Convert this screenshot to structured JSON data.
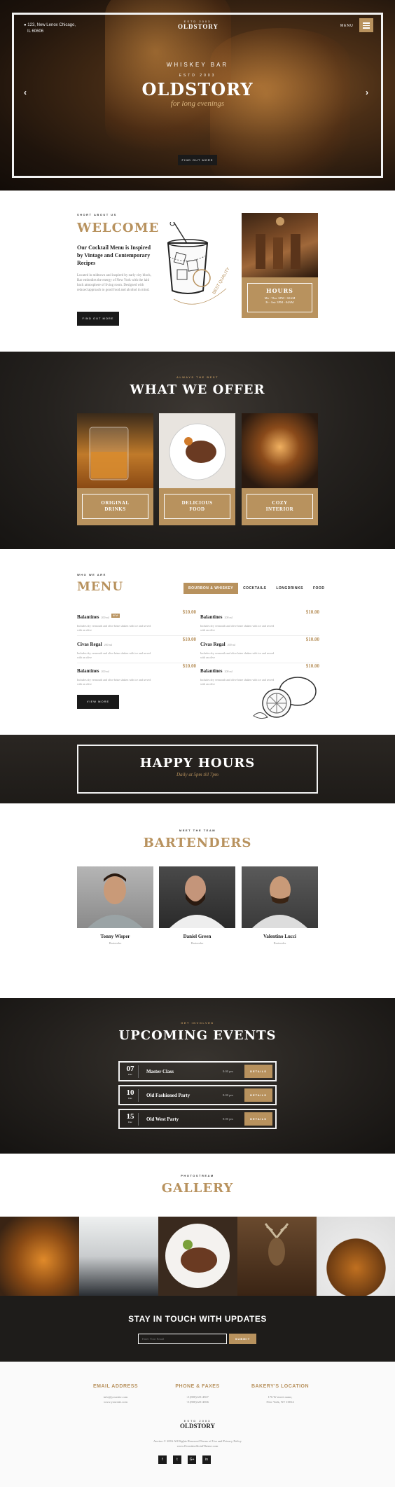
{
  "hero": {
    "address_line1": "123, New Lenox Chicago,",
    "address_line2": "IL 60606",
    "logo_est": "ESTD 2003",
    "logo_name": "OLDSTORY",
    "menu_label": "MENU",
    "arch_text": "WHISKEY BAR",
    "est_text": "ESTD 2003",
    "title": "OLDSTORY",
    "tagline": "for long evenings",
    "cta": "FIND OUT MORE"
  },
  "about": {
    "label": "SHORT ABOUT US",
    "title": "WELCOME",
    "lead": "Our Cocktail Menu is Inspired by Vintage and Contemporary Recipes",
    "body": "Located in midtown and inspired by early city block, Bar embodies the energy of New York with the laid back atmosphere of living room. Designed with relaxed approach to good food and alcohol in mind.",
    "button": "FIND OUT MORE",
    "sketch_text": "BEST QUALITY",
    "hours_title": "HOURS",
    "hours_line1": "Mo - Thu: 3PM - 02AM",
    "hours_line2": "Fr - Sat: 3PM - 04AM"
  },
  "offer": {
    "label": "ALWAYS THE BEST",
    "title": "WHAT WE OFFER",
    "cards": [
      {
        "line1": "ORIGINAL",
        "line2": "DRINKS"
      },
      {
        "line1": "DELICIOUS",
        "line2": "FOOD"
      },
      {
        "line1": "COZY",
        "line2": "INTERIOR"
      }
    ]
  },
  "menu": {
    "label": "WHO WE ARE",
    "title": "MENU",
    "tabs": [
      "BOURBON & WHISKEY",
      "COCKTAILS",
      "LONGDRINKS",
      "FOOD"
    ],
    "items": [
      {
        "name": "Balantines",
        "size": "200 ml",
        "badge": "NEW",
        "price": "$10.00",
        "desc": "Includes dry vermouth and olive brine shaken with ice and served with an olive"
      },
      {
        "name": "Balantines",
        "size": "200 ml",
        "badge": "",
        "price": "$10.00",
        "desc": "Includes dry vermouth and olive brine shaken with ice and served with an olive"
      },
      {
        "name": "Civas Regal",
        "size": "200 ml",
        "badge": "",
        "price": "$10.00",
        "desc": "Includes dry vermouth and olive brine shaken with ice and served with an olive"
      },
      {
        "name": "Civas Regal",
        "size": "200 ml",
        "badge": "",
        "price": "$10.00",
        "desc": "Includes dry vermouth and olive brine shaken with ice and served with an olive"
      },
      {
        "name": "Balantines",
        "size": "200 ml",
        "badge": "",
        "price": "$10.00",
        "desc": "Includes dry vermouth and olive brine shaken with ice and served with an olive"
      },
      {
        "name": "Balantines",
        "size": "200 ml",
        "badge": "",
        "price": "$10.00",
        "desc": "Includes dry vermouth and olive brine shaken with ice and served with an olive"
      }
    ],
    "button": "VIEW MORE"
  },
  "happy": {
    "title": "HAPPY HOURS",
    "subtitle": "Daily at 5pm till 7pm"
  },
  "bartenders": {
    "label": "MEET THE TEAM",
    "title": "BARTENDERS",
    "people": [
      {
        "name": "Tonny Wisper",
        "role": "Bartender"
      },
      {
        "name": "Daniel Green",
        "role": "Bartender"
      },
      {
        "name": "Valentino Lucci",
        "role": "Bartender"
      }
    ]
  },
  "events": {
    "label": "GET INVOLVED",
    "title": "UPCOMING EVENTS",
    "items": [
      {
        "day": "07",
        "month": "Dec",
        "name": "Master Class",
        "time": "8:00 pm",
        "button": "DETAILS"
      },
      {
        "day": "10",
        "month": "Dec",
        "name": "Old Fashioned Party",
        "time": "8:00 pm",
        "button": "DETAILS"
      },
      {
        "day": "15",
        "month": "Dec",
        "name": "Old West Party",
        "time": "8:00 pm",
        "button": "DETAILS"
      }
    ]
  },
  "gallery": {
    "label": "PHOTOSTREAM",
    "title": "GALLERY"
  },
  "newsletter": {
    "title": "STAY IN TOUCH WITH UPDATES",
    "placeholder": "Enter Your Email",
    "button": "SUBMIT"
  },
  "footer": {
    "col1_title": "EMAIL ADDRESS",
    "col1_line1": "info@yoursite.com",
    "col1_line2": "www.yoursite.com",
    "col2_title": "PHONE & FAXES",
    "col2_line1": "+1(800)123-4567",
    "col2_line2": "+1(800)123-4566",
    "col3_title": "BAKERY'S LOCATION",
    "col3_line1": "176 W street name,",
    "col3_line2": "New York, NY 10014",
    "logo_est": "ESTD 2003",
    "logo_name": "OLDSTORY",
    "copyright": "Anvioo © 2016 All Rights Reserved Terms of Use and Privacy Policy",
    "site": "www.EvoniteofficialTheme.com",
    "social": [
      "f",
      "t",
      "G+",
      "in"
    ]
  },
  "colors": {
    "accent": "#b8925e",
    "dark": "#1e1c1a"
  }
}
